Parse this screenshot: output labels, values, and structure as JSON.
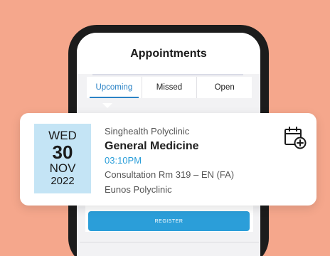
{
  "screen": {
    "title": "Appointments"
  },
  "tabs": [
    {
      "label": "Upcoming",
      "active": true
    },
    {
      "label": "Missed",
      "active": false
    },
    {
      "label": "Open",
      "active": false
    }
  ],
  "appointment": {
    "day": "WED",
    "date": "30",
    "month": "NOV",
    "year": "2022",
    "provider": "Singhealth Polyclinic",
    "service": "General Medicine",
    "time": "03:10PM",
    "room": "Consultation Rm 319 – EN (FA)",
    "location": "Eunos Polyclinic"
  },
  "register_label": "REGISTER",
  "colors": {
    "background": "#f5a78c",
    "accent": "#2b83c6",
    "date_box": "#c4e4f5",
    "register_button": "#2b9ed9"
  },
  "icons": {
    "add_calendar": "calendar-plus-icon"
  }
}
